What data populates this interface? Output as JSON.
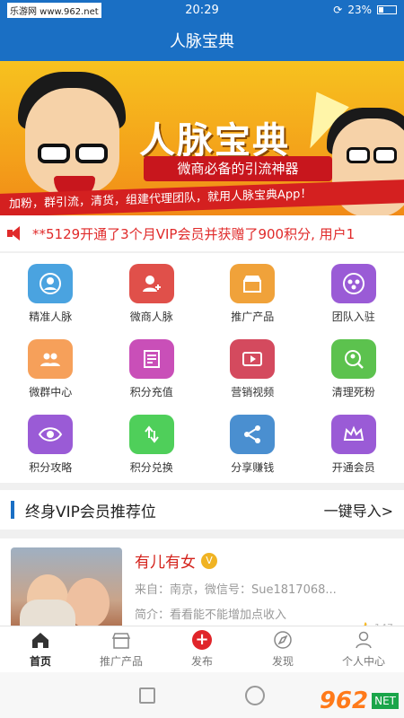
{
  "status_bar": {
    "watermark": "乐游网 www.962.net",
    "time": "20:29",
    "battery": "23%"
  },
  "header": {
    "title": "人脉宝典"
  },
  "banner": {
    "title": "人脉宝典",
    "tagline": "微商必备的引流神器",
    "ribbon": "加粉，群引流，清货，组建代理团队，就用人脉宝典App！"
  },
  "marquee": {
    "text": "**5129开通了3个月VIP会员并获赠了900积分, 用户1"
  },
  "features": [
    {
      "label": "精准人脉",
      "icon": "person-circle-icon",
      "color": "#4aa3e0"
    },
    {
      "label": "微商人脉",
      "icon": "add-person-icon",
      "color": "#e0504a"
    },
    {
      "label": "推广产品",
      "icon": "store-icon",
      "color": "#f0a23a"
    },
    {
      "label": "团队入驻",
      "icon": "team-icon",
      "color": "#9a5bd6"
    },
    {
      "label": "微群中心",
      "icon": "group-icon",
      "color": "#f6a05a"
    },
    {
      "label": "积分充值",
      "icon": "document-icon",
      "color": "#c94fb8"
    },
    {
      "label": "营销视频",
      "icon": "video-icon",
      "color": "#d44a5e"
    },
    {
      "label": "清理死粉",
      "icon": "clean-icon",
      "color": "#5cc24e"
    },
    {
      "label": "积分攻略",
      "icon": "eye-icon",
      "color": "#9a5bd6"
    },
    {
      "label": "积分兑换",
      "icon": "exchange-icon",
      "color": "#4fcf5a"
    },
    {
      "label": "分享赚钱",
      "icon": "share-icon",
      "color": "#4a8fd0"
    },
    {
      "label": "开通会员",
      "icon": "crown-icon",
      "color": "#9a5bd6"
    }
  ],
  "vip_section": {
    "title": "终身VIP会员推荐位",
    "action": "一键导入>"
  },
  "vip_card": {
    "name": "有儿有女",
    "badge": "V",
    "location": "来自：南京，微信号：Sue1817068...",
    "intro": "简介：看看能不能增加点收入",
    "views": "147"
  },
  "tabs": [
    {
      "label": "首页",
      "icon": "home-icon",
      "active": true
    },
    {
      "label": "推广产品",
      "icon": "store-icon",
      "active": false
    },
    {
      "label": "发布",
      "icon": "plus-icon",
      "active": false
    },
    {
      "label": "发现",
      "icon": "compass-icon",
      "active": false
    },
    {
      "label": "个人中心",
      "icon": "person-icon",
      "active": false
    }
  ],
  "footer_watermark": {
    "number": "962",
    "net": "NET",
    "site": "乐游网"
  },
  "colors": {
    "primary": "#1a6fc4",
    "accent": "#d4221b"
  }
}
